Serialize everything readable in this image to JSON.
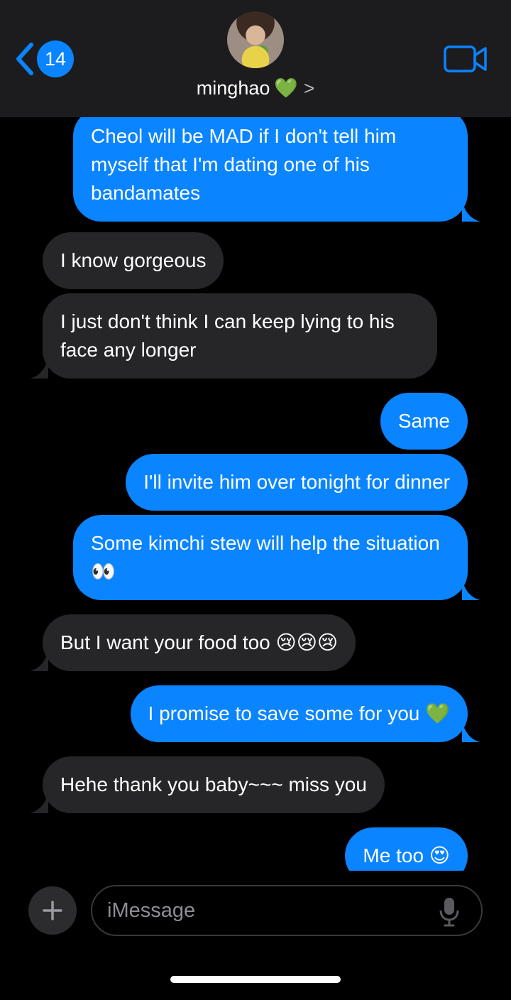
{
  "header": {
    "back_badge": "14",
    "contact_name": "minghao",
    "contact_emoji": "💚",
    "chevron": ">"
  },
  "messages": [
    {
      "from": "me",
      "text": "Cheol will be MAD if I don't tell him myself that I'm dating one of his bandamates"
    },
    {
      "from": "them",
      "text": "I know gorgeous"
    },
    {
      "from": "them",
      "text": "I just don't think I can keep lying to his face any longer"
    },
    {
      "from": "me",
      "text": "Same"
    },
    {
      "from": "me",
      "text": "I'll invite him over tonight for dinner"
    },
    {
      "from": "me",
      "text": "Some kimchi stew will help the situation 👀"
    },
    {
      "from": "them",
      "text": "But I want your food too 😢😢😢"
    },
    {
      "from": "me",
      "text": "I promise to save some for you 💚"
    },
    {
      "from": "them",
      "text": "Hehe thank you baby~~~ miss you"
    },
    {
      "from": "me",
      "text": "Me too 😍"
    }
  ],
  "composer": {
    "placeholder": "iMessage"
  },
  "colors": {
    "sent_bubble": "#0a84ff",
    "received_bubble": "#262629",
    "header_bg": "#1c1c1e",
    "background": "#000000"
  },
  "icons": [
    "back-chevron-icon",
    "video-camera-icon",
    "plus-icon",
    "microphone-icon"
  ]
}
